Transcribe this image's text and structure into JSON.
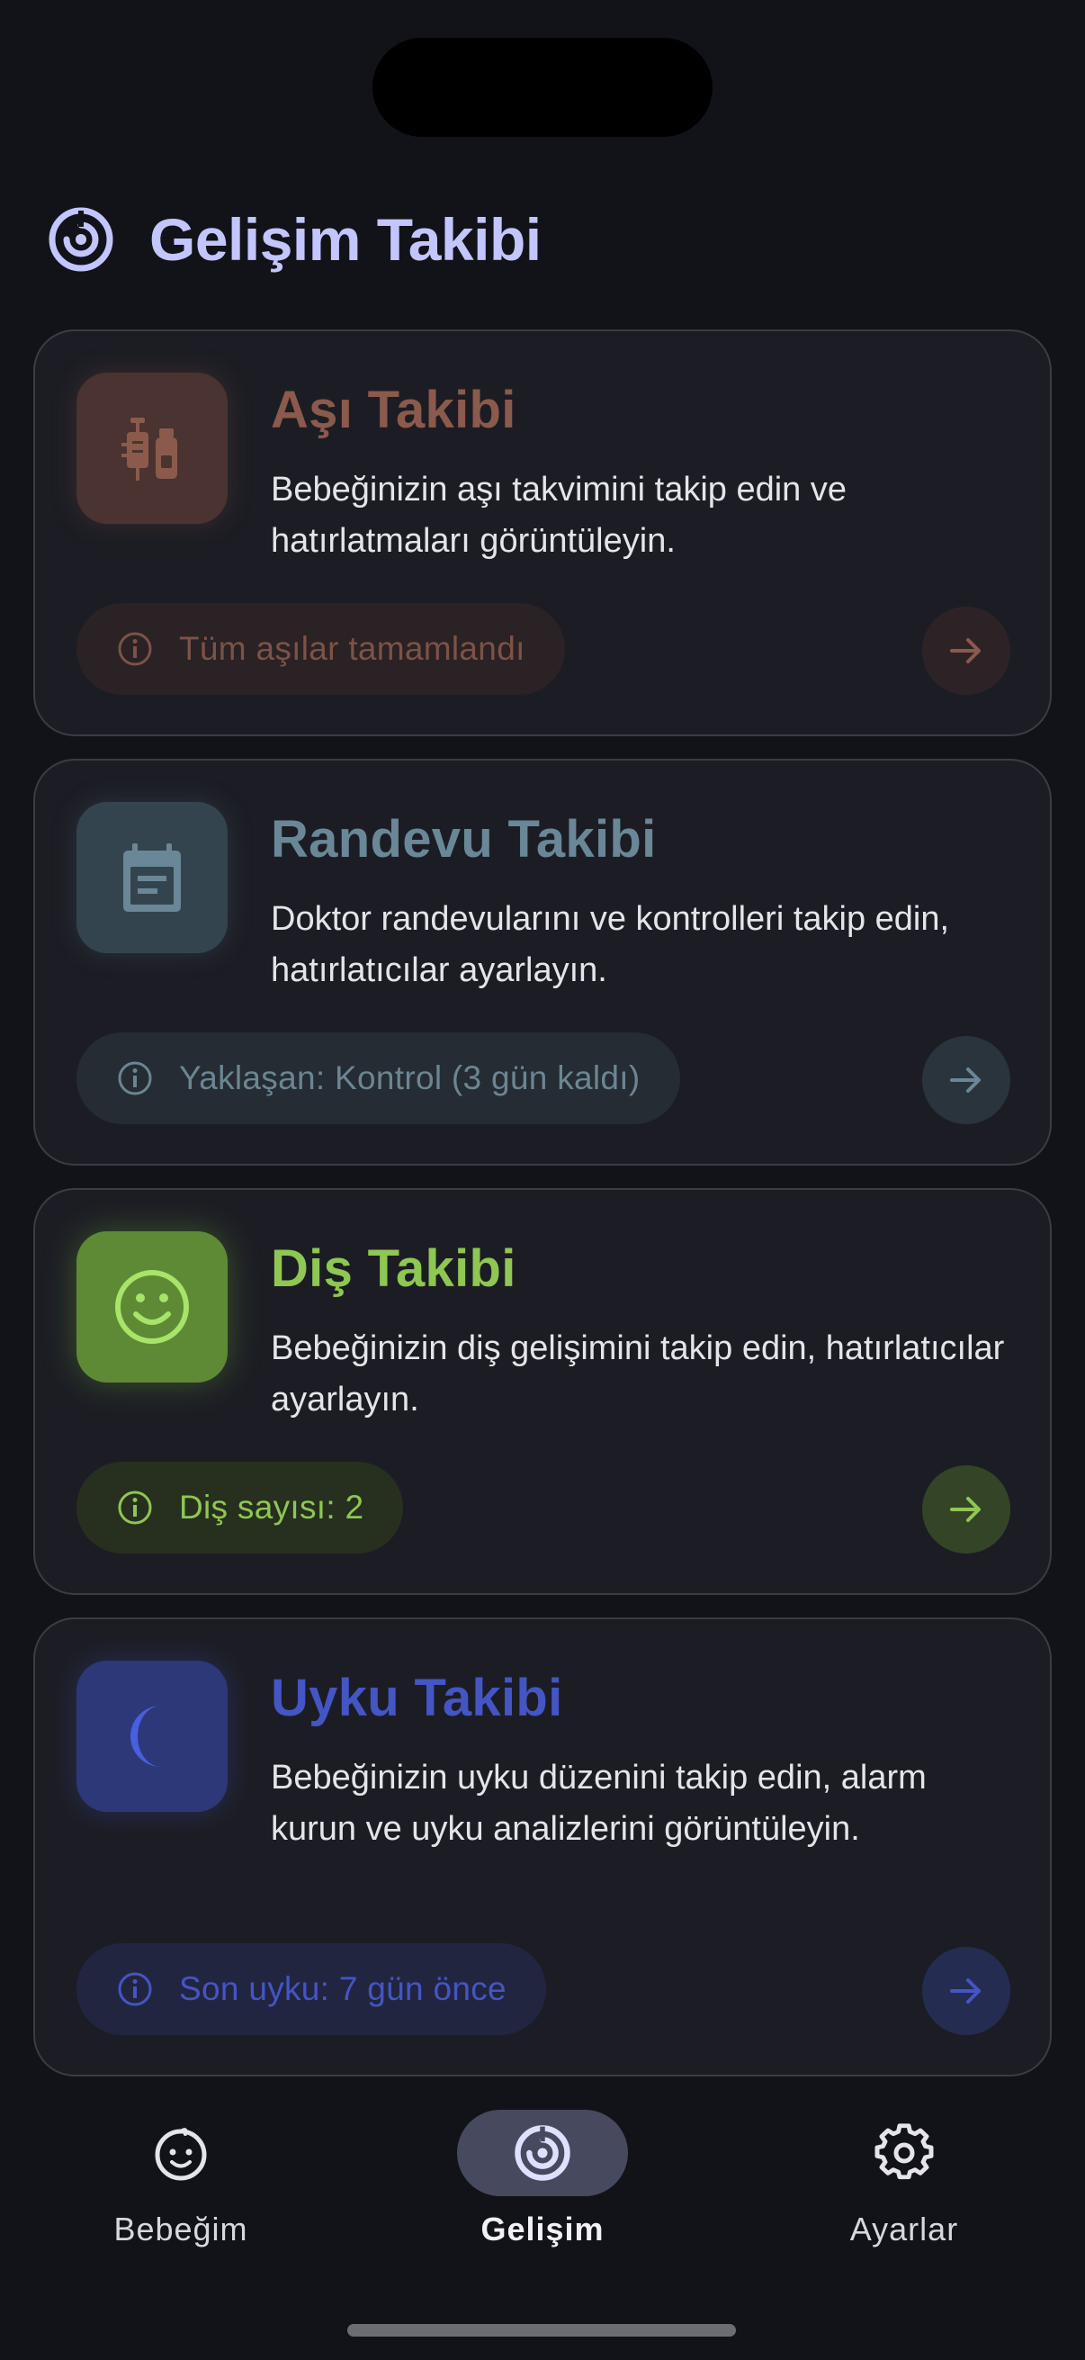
{
  "app": {
    "page_title": "Gelişim Takibi",
    "title_icon": "development-radar-icon",
    "accent_color": "#c3c5ff"
  },
  "cards": [
    {
      "id": "asi",
      "title": "Aşı Takibi",
      "description": "Bebeğinizin aşı takvimini takip edin ve hatırlatmaları görüntüleyin.",
      "status": "Tüm aşılar tamamlandı",
      "icon": "vaccine-syringe-icon",
      "color": "#8b5a4c"
    },
    {
      "id": "randevu",
      "title": "Randevu Takibi",
      "description": "Doktor randevularını ve kontrolleri takip edin, hatırlatıcılar ayarlayın.",
      "status": "Yaklaşan: Kontrol (3 gün kaldı)",
      "icon": "calendar-icon",
      "color": "#6a8797"
    },
    {
      "id": "dis",
      "title": "Diş Takibi",
      "description": "Bebeğinizin diş gelişimini takip edin, hatırlatıcılar ayarlayın.",
      "status": "Diş sayısı: 2",
      "icon": "smiley-face-icon",
      "color": "#8ec751"
    },
    {
      "id": "uyku",
      "title": "Uyku Takibi",
      "description": "Bebeğinizin uyku düzenini takip edin, alarm kurun ve uyku analizlerini görüntüleyin.",
      "status": "Son uyku: 7 gün önce",
      "icon": "moon-icon",
      "color": "#4455c4"
    }
  ],
  "nav": {
    "items": [
      {
        "label": "Bebeğim",
        "icon": "baby-face-icon",
        "active": false
      },
      {
        "label": "Gelişim",
        "icon": "development-radar-icon",
        "active": true
      },
      {
        "label": "Ayarlar",
        "icon": "gear-icon",
        "active": false
      }
    ]
  }
}
